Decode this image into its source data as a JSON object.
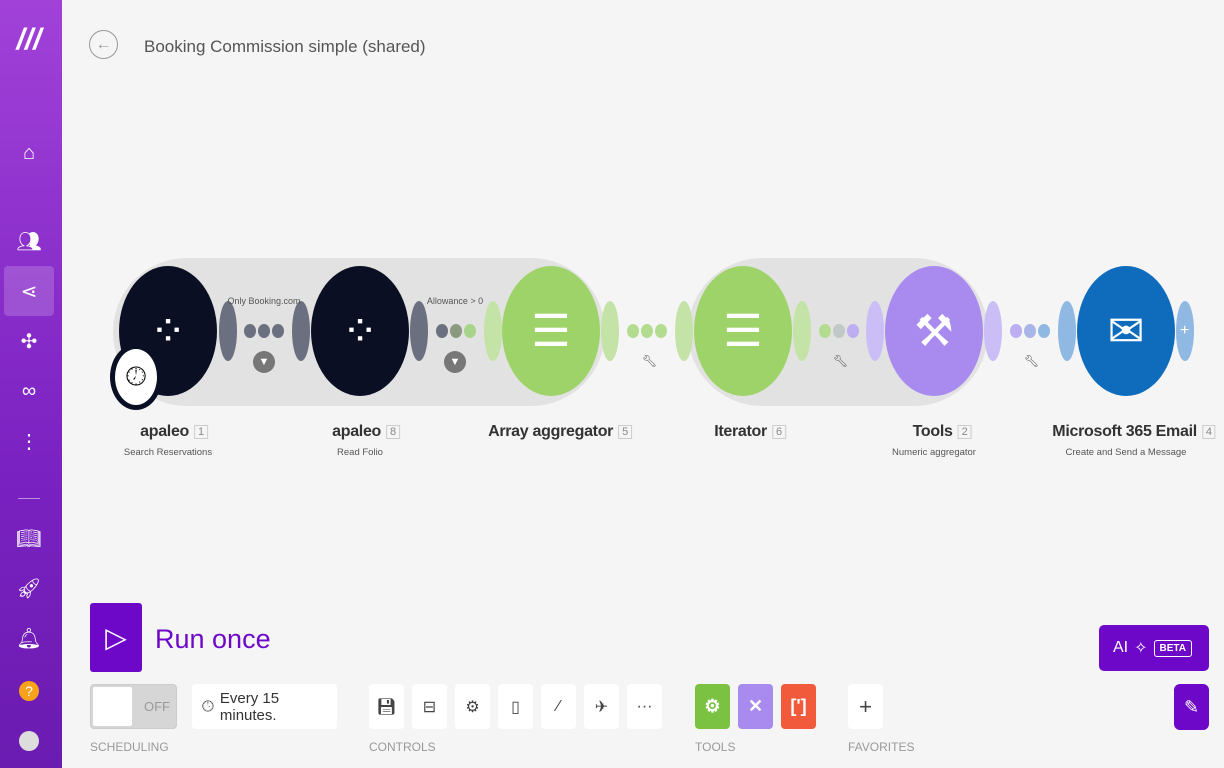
{
  "header": {
    "title": "Booking Commission simple (shared)",
    "back_icon": "arrow-left-icon"
  },
  "sidebar": {
    "items": [
      "logo",
      "home",
      "team",
      "scenarios",
      "apps",
      "connections",
      "more",
      "docs",
      "launch",
      "notifications",
      "help",
      "avatar"
    ]
  },
  "modules": [
    {
      "name": "apaleo",
      "id": "1",
      "subtitle": "Search Reservations",
      "color": "#0a0f24"
    },
    {
      "name": "apaleo",
      "id": "8",
      "subtitle": "Read Folio",
      "color": "#0a0f24"
    },
    {
      "name": "Array aggregator",
      "id": "5",
      "subtitle": "",
      "color": "#9ed36a"
    },
    {
      "name": "Iterator",
      "id": "6",
      "subtitle": "",
      "color": "#9ed36a"
    },
    {
      "name": "Tools",
      "id": "2",
      "subtitle": "Numeric aggregator",
      "color": "#a98bf0"
    },
    {
      "name": "Microsoft 365 Email",
      "id": "4",
      "subtitle": "Create and Send a Message",
      "color": "#0f6cbd"
    }
  ],
  "filters": [
    "Only Booking.com",
    "Allowance > 0"
  ],
  "run": {
    "label": "Run once"
  },
  "scheduling": {
    "toggle": "OFF",
    "interval": "Every 15 minutes.",
    "label": "SCHEDULING"
  },
  "controls": {
    "label": "CONTROLS",
    "more": "···"
  },
  "tools": {
    "label": "TOOLS",
    "colors": [
      "#7cc242",
      "#a98bf0",
      "#f15a3a"
    ]
  },
  "favorites": {
    "label": "FAVORITES",
    "add": "+"
  },
  "ai": {
    "label": "AI",
    "badge": "BETA"
  }
}
